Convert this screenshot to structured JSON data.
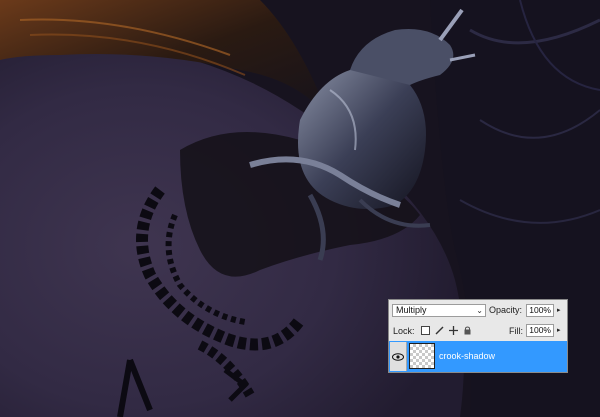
{
  "canvas": {
    "description_icon": "photo-canvas"
  },
  "layers_panel": {
    "blend_mode": "Multiply",
    "opacity_label": "Opacity:",
    "opacity_value": "100%",
    "lock_label": "Lock:",
    "fill_label": "Fill:",
    "fill_value": "100%",
    "layer_name": "crook-shadow",
    "selected_color": "#3399ff",
    "icons": [
      "chevron-down-icon",
      "arrow-right-icon",
      "lock-transparent-icon",
      "lock-brush-icon",
      "lock-move-icon",
      "lock-all-icon",
      "eye-icon",
      "layer-thumbnail"
    ]
  }
}
